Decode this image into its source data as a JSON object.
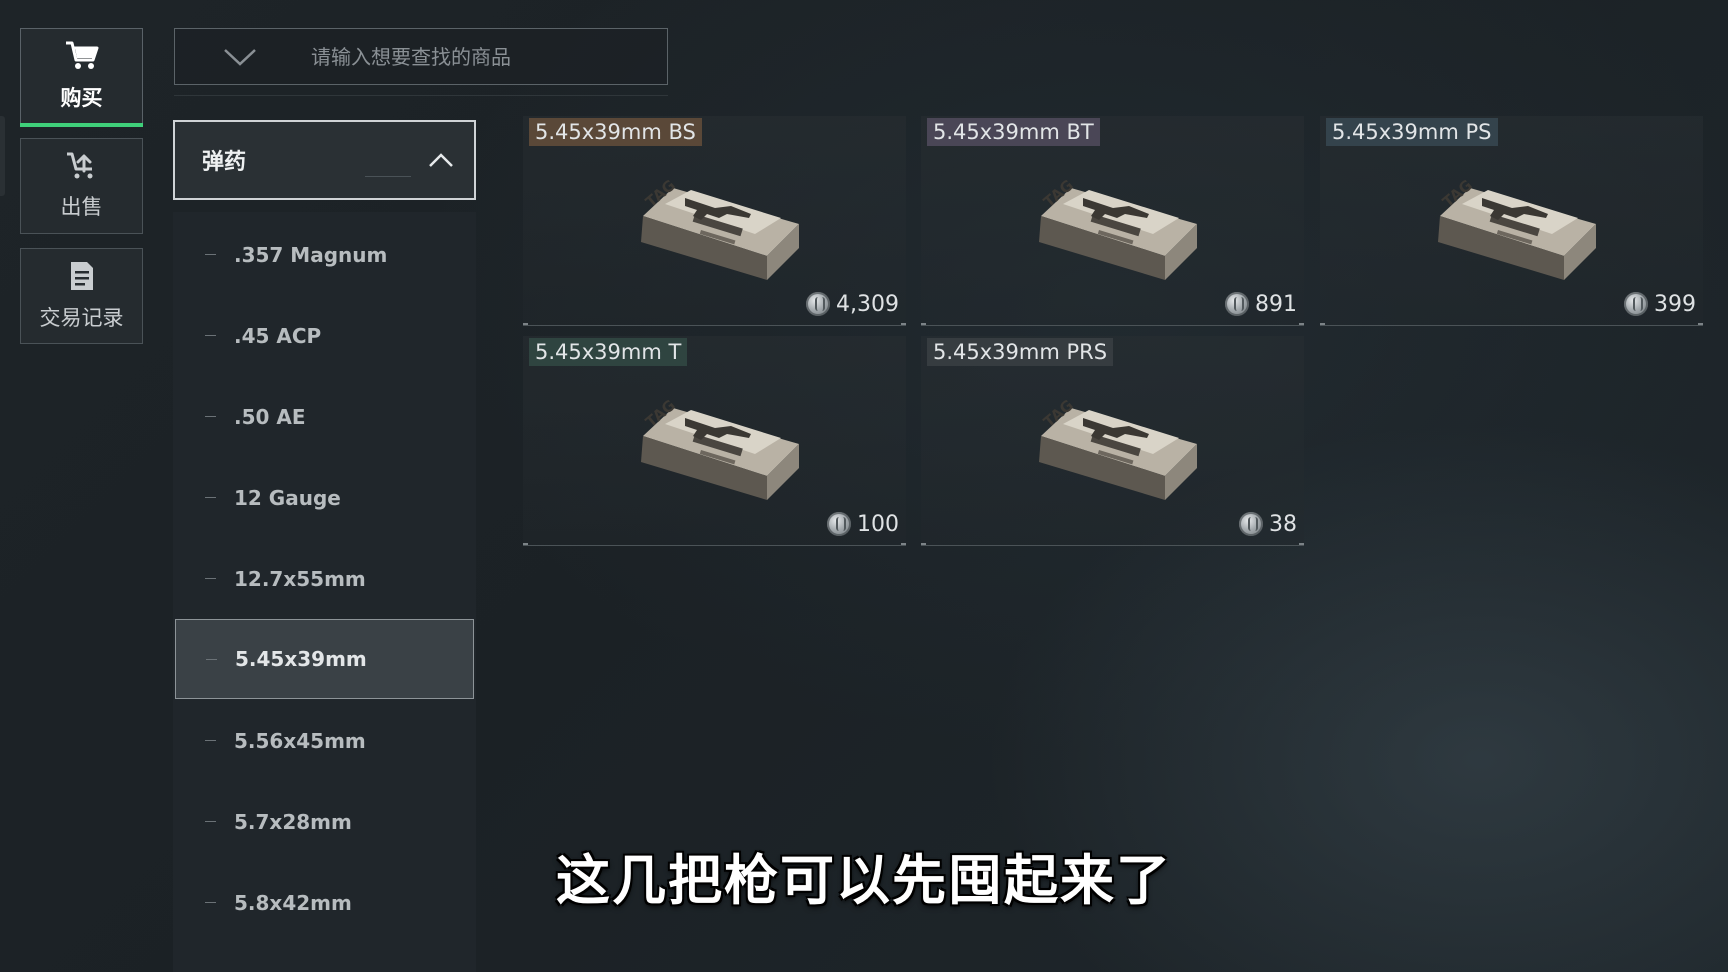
{
  "nav": [
    {
      "key": "buy",
      "label": "购买",
      "icon": "cart-icon",
      "active": true
    },
    {
      "key": "sell",
      "label": "出售",
      "icon": "sell-icon",
      "active": false
    },
    {
      "key": "history",
      "label": "交易记录",
      "icon": "document-icon",
      "active": false
    }
  ],
  "search": {
    "placeholder": "请输入想要查找的商品"
  },
  "category": {
    "title": "弹药",
    "items": [
      ".357 Magnum",
      ".45 ACP",
      ".50 AE",
      "12 Gauge",
      "12.7x55mm",
      "5.45x39mm",
      "5.56x45mm",
      "5.7x28mm",
      "5.8x42mm"
    ],
    "selected": "5.45x39mm"
  },
  "products": [
    {
      "name": "5.45x39mm BS",
      "price": "4,309",
      "tag_color": "#5a4838"
    },
    {
      "name": "5.45x39mm BT",
      "price": "891",
      "tag_color": "#4a4656"
    },
    {
      "name": "5.45x39mm PS",
      "price": "399",
      "tag_color": "#34434c"
    },
    {
      "name": "5.45x39mm T",
      "price": "100",
      "tag_color": "#2f4440"
    },
    {
      "name": "5.45x39mm PRS",
      "price": "38",
      "tag_color": "#363c40"
    }
  ],
  "subtitle": "这几把枪可以先囤起来了",
  "colors": {
    "accent": "#3fd07a",
    "background": "#1e2428"
  }
}
